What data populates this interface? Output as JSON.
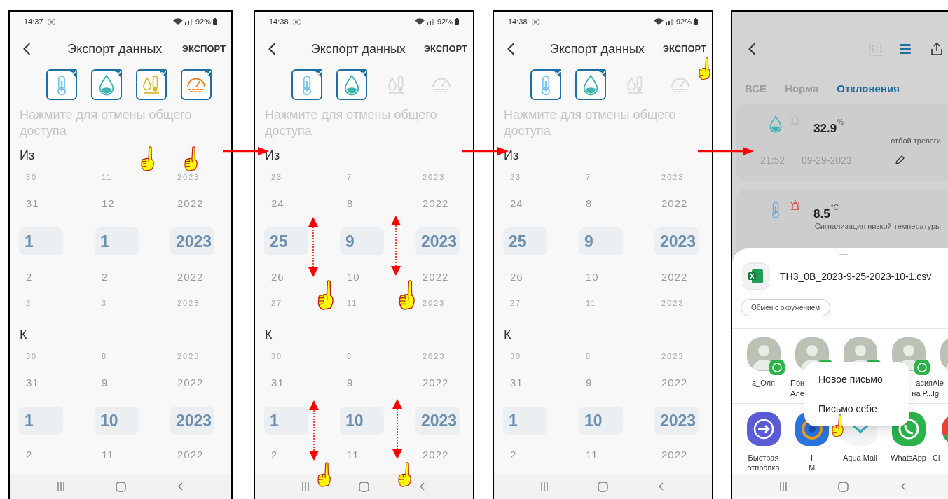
{
  "panels": [
    {
      "kind": "export",
      "status_bar": {
        "time": "14:37",
        "battery": "92%"
      },
      "title": "Экспорт данных",
      "action": "ЭКСПОРТ",
      "sensors": [
        {
          "kind": "temperature",
          "selected": true
        },
        {
          "kind": "humidity",
          "selected": true
        },
        {
          "kind": "dew_point",
          "selected": true
        },
        {
          "kind": "pressure",
          "selected": true
        }
      ],
      "hint": "Нажмите для отмены общего доступа",
      "ranges": [
        {
          "label": "Из",
          "columns": [
            {
              "items": [
                {
                  "text": "30",
                  "selected": false
                },
                {
                  "text": "31",
                  "selected": false
                },
                {
                  "text": "1",
                  "selected": true
                },
                {
                  "text": "2",
                  "selected": false
                },
                {
                  "text": "3",
                  "selected": false
                }
              ]
            },
            {
              "items": [
                {
                  "text": "11",
                  "selected": false
                },
                {
                  "text": "12",
                  "selected": false
                },
                {
                  "text": "1",
                  "selected": true
                },
                {
                  "text": "2",
                  "selected": false
                },
                {
                  "text": "3",
                  "selected": false
                }
              ]
            },
            {
              "items": [
                {
                  "text": "2023",
                  "selected": false
                },
                {
                  "text": "2022",
                  "selected": false
                },
                {
                  "text": "2023",
                  "selected": true
                },
                {
                  "text": "2022",
                  "selected": false
                },
                {
                  "text": "2023",
                  "selected": false
                }
              ]
            }
          ]
        },
        {
          "label": "К",
          "columns": [
            {
              "items": [
                {
                  "text": "30",
                  "selected": false
                },
                {
                  "text": "31",
                  "selected": false
                },
                {
                  "text": "1",
                  "selected": true
                },
                {
                  "text": "2",
                  "selected": false
                }
              ]
            },
            {
              "items": [
                {
                  "text": "8",
                  "selected": false
                },
                {
                  "text": "9",
                  "selected": false
                },
                {
                  "text": "10",
                  "selected": true
                },
                {
                  "text": "11",
                  "selected": false
                }
              ]
            },
            {
              "items": [
                {
                  "text": "2023",
                  "selected": false
                },
                {
                  "text": "2022",
                  "selected": false
                },
                {
                  "text": "2023",
                  "selected": true
                },
                {
                  "text": "2022",
                  "selected": false
                }
              ]
            }
          ]
        }
      ]
    },
    {
      "kind": "export",
      "status_bar": {
        "time": "14:38",
        "battery": "92%"
      },
      "title": "Экспорт данных",
      "action": "ЭКСПОРТ",
      "sensors": [
        {
          "kind": "temperature",
          "selected": true
        },
        {
          "kind": "humidity",
          "selected": true
        },
        {
          "kind": "dew_point",
          "selected": false
        },
        {
          "kind": "pressure",
          "selected": false
        }
      ],
      "hint": "Нажмите для отмены общего доступа",
      "ranges": [
        {
          "label": "Из",
          "columns": [
            {
              "items": [
                {
                  "text": "23",
                  "selected": false
                },
                {
                  "text": "24",
                  "selected": false
                },
                {
                  "text": "25",
                  "selected": true
                },
                {
                  "text": "26",
                  "selected": false
                },
                {
                  "text": "27",
                  "selected": false
                }
              ]
            },
            {
              "items": [
                {
                  "text": "7",
                  "selected": false
                },
                {
                  "text": "8",
                  "selected": false
                },
                {
                  "text": "9",
                  "selected": true
                },
                {
                  "text": "10",
                  "selected": false
                },
                {
                  "text": "11",
                  "selected": false
                }
              ]
            },
            {
              "items": [
                {
                  "text": "2023",
                  "selected": false
                },
                {
                  "text": "2022",
                  "selected": false
                },
                {
                  "text": "2023",
                  "selected": true
                },
                {
                  "text": "2022",
                  "selected": false
                },
                {
                  "text": "2023",
                  "selected": false
                }
              ]
            }
          ]
        },
        {
          "label": "К",
          "columns": [
            {
              "items": [
                {
                  "text": "30",
                  "selected": false
                },
                {
                  "text": "31",
                  "selected": false
                },
                {
                  "text": "1",
                  "selected": true
                },
                {
                  "text": "2",
                  "selected": false
                }
              ]
            },
            {
              "items": [
                {
                  "text": "8",
                  "selected": false
                },
                {
                  "text": "9",
                  "selected": false
                },
                {
                  "text": "10",
                  "selected": true
                },
                {
                  "text": "11",
                  "selected": false
                }
              ]
            },
            {
              "items": [
                {
                  "text": "2023",
                  "selected": false
                },
                {
                  "text": "2022",
                  "selected": false
                },
                {
                  "text": "2023",
                  "selected": true
                },
                {
                  "text": "2022",
                  "selected": false
                }
              ]
            }
          ]
        }
      ]
    },
    {
      "kind": "export",
      "status_bar": {
        "time": "14:38",
        "battery": "92%"
      },
      "title": "Экспорт данных",
      "action": "ЭКСПОРТ",
      "sensors": [
        {
          "kind": "temperature",
          "selected": true
        },
        {
          "kind": "humidity",
          "selected": true
        },
        {
          "kind": "dew_point",
          "selected": false
        },
        {
          "kind": "pressure",
          "selected": false
        }
      ],
      "hint": "Нажмите для отмены общего доступа",
      "ranges": [
        {
          "label": "Из",
          "columns": [
            {
              "items": [
                {
                  "text": "23",
                  "selected": false
                },
                {
                  "text": "24",
                  "selected": false
                },
                {
                  "text": "25",
                  "selected": true
                },
                {
                  "text": "26",
                  "selected": false
                },
                {
                  "text": "27",
                  "selected": false
                }
              ]
            },
            {
              "items": [
                {
                  "text": "7",
                  "selected": false
                },
                {
                  "text": "8",
                  "selected": false
                },
                {
                  "text": "9",
                  "selected": true
                },
                {
                  "text": "10",
                  "selected": false
                },
                {
                  "text": "11",
                  "selected": false
                }
              ]
            },
            {
              "items": [
                {
                  "text": "2023",
                  "selected": false
                },
                {
                  "text": "2022",
                  "selected": false
                },
                {
                  "text": "2023",
                  "selected": true
                },
                {
                  "text": "2022",
                  "selected": false
                },
                {
                  "text": "2023",
                  "selected": false
                }
              ]
            }
          ]
        },
        {
          "label": "К",
          "columns": [
            {
              "items": [
                {
                  "text": "30",
                  "selected": false
                },
                {
                  "text": "31",
                  "selected": false
                },
                {
                  "text": "1",
                  "selected": true
                },
                {
                  "text": "2",
                  "selected": false
                }
              ]
            },
            {
              "items": [
                {
                  "text": "8",
                  "selected": false
                },
                {
                  "text": "9",
                  "selected": false
                },
                {
                  "text": "10",
                  "selected": true
                },
                {
                  "text": "11",
                  "selected": false
                }
              ]
            },
            {
              "items": [
                {
                  "text": "2023",
                  "selected": false
                },
                {
                  "text": "2022",
                  "selected": false
                },
                {
                  "text": "2023",
                  "selected": true
                },
                {
                  "text": "2022",
                  "selected": false
                }
              ]
            }
          ]
        }
      ]
    },
    {
      "kind": "share",
      "tabs": [
        {
          "label": "ВСЕ",
          "selected": false
        },
        {
          "label": "Норма",
          "selected": false
        },
        {
          "label": "Отклонения",
          "selected": true
        }
      ],
      "records": [
        {
          "kind": "humidity",
          "alarm_active": false,
          "value": "32.9",
          "unit": "%",
          "status": "отбой тревоги",
          "time": "21:52",
          "date": "09-29-2023"
        },
        {
          "kind": "temperature",
          "alarm_active": true,
          "value": "8.5",
          "unit": "°C",
          "status": "Сигнализация низкой температуры"
        }
      ],
      "share_sheet": {
        "file_name": "TH3_0B_2023-9-25-2023-10-1.csv",
        "chip": "Обмен с окружением",
        "contacts": [
          {
            "kind": "whatsapp",
            "name_lines": [
              "а_Оля"
            ]
          },
          {
            "kind": "whatsapp",
            "name_lines": [
              "Пон",
              "Але"
            ]
          },
          {
            "kind": "whatsapp"
          },
          {
            "kind": "whatsapp",
            "name_lines": [
              "асия",
              "на Р..."
            ]
          },
          {
            "kind": "plain",
            "name_lines": [
              "Ale",
              "Ig"
            ]
          }
        ],
        "apps": [
          {
            "kind": "quick_share",
            "label_lines": [
              "Быстрая",
              "отправка"
            ]
          },
          {
            "kind": "rings",
            "label_lines": [
              "I",
              "M"
            ]
          },
          {
            "kind": "mail",
            "label_lines": [
              "Aqua Mail"
            ]
          },
          {
            "kind": "whatsapp",
            "label_lines": [
              "WhatsApp"
            ]
          },
          {
            "kind": "browser",
            "label_lines": [
              "Cl"
            ]
          }
        ],
        "menu": [
          "Новое письмо",
          "Письмо себе"
        ]
      }
    }
  ]
}
